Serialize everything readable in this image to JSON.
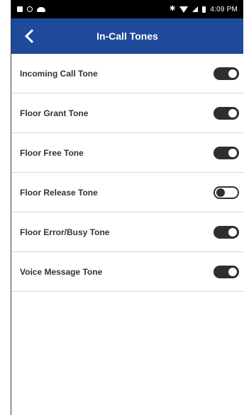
{
  "status_bar": {
    "left_icons": [
      "square-notification-icon",
      "circle-notification-icon",
      "cloud-icon"
    ],
    "right_icons": [
      "bluetooth-icon",
      "wifi-icon",
      "signal-icon",
      "battery-icon"
    ],
    "time": "4:09 PM"
  },
  "header": {
    "title": "In-Call Tones",
    "background_color": "#1e4a9a"
  },
  "settings": [
    {
      "label": "Incoming Call Tone",
      "enabled": true
    },
    {
      "label": "Floor Grant Tone",
      "enabled": true
    },
    {
      "label": "Floor Free Tone",
      "enabled": true
    },
    {
      "label": "Floor Release Tone",
      "enabled": false
    },
    {
      "label": "Floor Error/Busy Tone",
      "enabled": true
    },
    {
      "label": "Voice Message Tone",
      "enabled": true
    }
  ]
}
